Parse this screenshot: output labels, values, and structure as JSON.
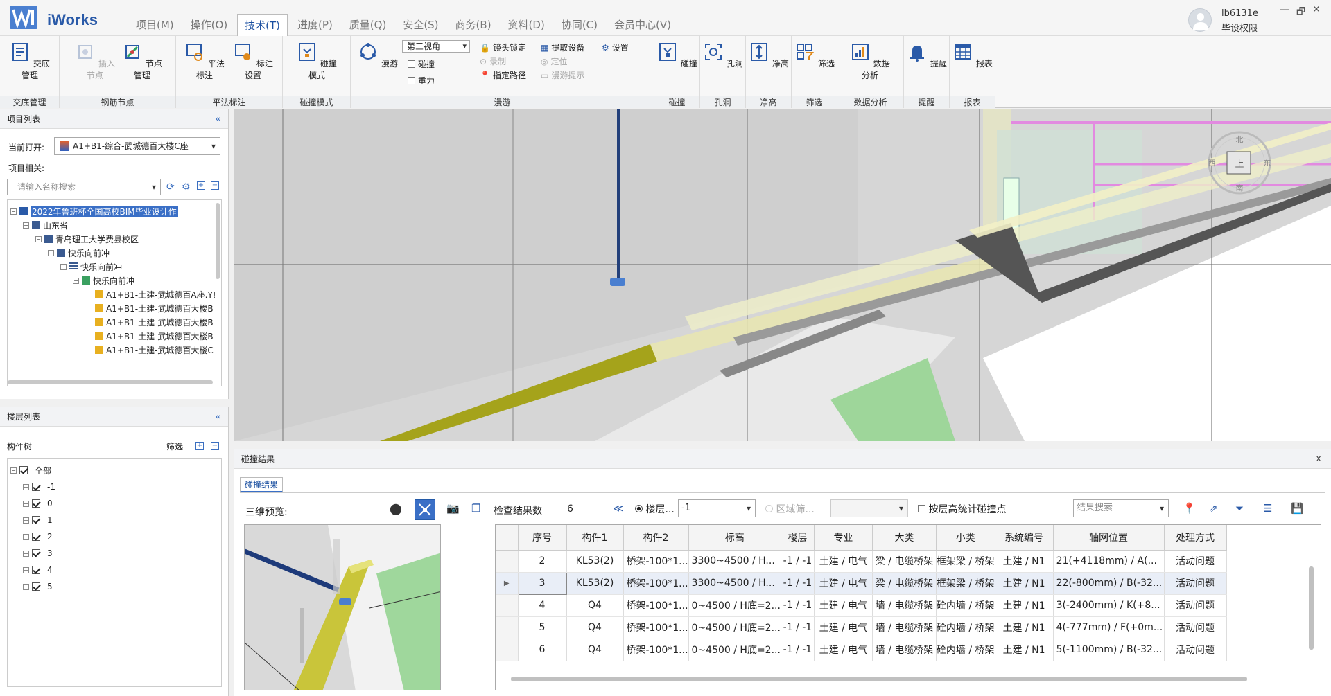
{
  "app": {
    "name": "iWorks"
  },
  "menu": [
    "项目(M)",
    "操作(O)",
    "技术(T)",
    "进度(P)",
    "质量(Q)",
    "安全(S)",
    "商务(B)",
    "资料(D)",
    "协同(C)",
    "会员中心(V)"
  ],
  "menu_active": "技术(T)",
  "user": {
    "name": "lb6131e",
    "role": "毕设权限"
  },
  "window_controls": [
    "—",
    "🗗",
    "✕"
  ],
  "ribbon": {
    "groups": {
      "jiaodi": "交底管理",
      "gangjin": "钢筋节点",
      "pingfa": "平法标注",
      "pengzhuang_mode": "碰撞模式",
      "manyou": "漫游",
      "pengzhuang": "碰撞",
      "kongdong": "孔洞",
      "jinggao": "净高",
      "shaixuan": "筛选",
      "shuju": "数据分析",
      "tixing": "提醒",
      "baobiao": "报表"
    },
    "buttons": {
      "jiaodi": "交底管理",
      "charu": "插入节点",
      "jiedian": "节点管理",
      "pingfa": "平法标注",
      "biaozhu": "标注设置",
      "pengzhuang_mode": "碰撞模式",
      "manyou": "漫游",
      "pengzhuang": "碰撞",
      "kongdong": "孔洞",
      "jinggao": "净高",
      "shaixuan": "筛选",
      "shuju": "数据分析",
      "tixing": "提醒",
      "baobiao": "报表"
    },
    "manyou_opts": {
      "view": "第三视角",
      "pengzhuang_chk": "碰撞",
      "zhongli_chk": "重力",
      "lock": "镜头锁定",
      "record": "录制",
      "path": "指定路径",
      "extract": "提取设备",
      "locate": "定位",
      "tip": "漫游提示",
      "settings": "设置"
    }
  },
  "project_panel": {
    "title": "项目列表",
    "collapse": "«",
    "current_label": "当前打开:",
    "current_value": "A1+B1-综合-武城德百大楼C座",
    "related_label": "项目相关:",
    "search_placeholder": "请输入名称搜索",
    "tree": [
      "2022年鲁班杯全国高校BIM毕业设计作",
      "山东省",
      "青岛理工大学费县校区",
      "快乐向前冲",
      "快乐向前冲",
      "快乐向前冲",
      "A1+B1-土建-武城德百A座.Y!",
      "A1+B1-土建-武城德百大楼B",
      "A1+B1-土建-武城德百大楼B",
      "A1+B1-土建-武城德百大楼B",
      "A1+B1-土建-武城德百大楼C"
    ]
  },
  "floor_panel": {
    "title": "楼层列表",
    "collapse": "«",
    "tree_label": "构件树",
    "filter": "筛选",
    "floors": [
      "全部",
      "-1",
      "0",
      "1",
      "2",
      "3",
      "4",
      "5"
    ]
  },
  "compass": {
    "n": "北",
    "s": "南",
    "w": "西",
    "e": "东",
    "center": "上"
  },
  "results": {
    "title": "碰撞结果",
    "close": "x",
    "tab": "碰撞结果",
    "preview_label": "三维预览:",
    "count_label": "检查结果数",
    "count": "6",
    "floor_radio": "楼层...",
    "floor_value": "-1",
    "region_radio": "区域筛...",
    "stat_chk": "按层高统计碰撞点",
    "search_placeholder": "结果搜索",
    "columns": [
      "序号",
      "构件1",
      "构件2",
      "标高",
      "楼层",
      "专业",
      "大类",
      "小类",
      "系统编号",
      "轴网位置",
      "处理方式"
    ],
    "rows": [
      [
        "2",
        "KL53(2)",
        "桥架-100*1...",
        "3300~4500 / H...",
        "-1 / -1",
        "土建 / 电气",
        "梁 / 电缆桥架",
        "框架梁 / 桥架",
        "土建 / N1",
        "21(+4118mm) / A(...",
        "活动问题"
      ],
      [
        "3",
        "KL53(2)",
        "桥架-100*1...",
        "3300~4500 / H...",
        "-1 / -1",
        "土建 / 电气",
        "梁 / 电缆桥架",
        "框架梁 / 桥架",
        "土建 / N1",
        "22(-800mm) / B(-32...",
        "活动问题"
      ],
      [
        "4",
        "Q4",
        "桥架-100*1...",
        "0~4500 / H底=2...",
        "-1 / -1",
        "土建 / 电气",
        "墙 / 电缆桥架",
        "砼内墙 / 桥架",
        "土建 / N1",
        "3(-2400mm) / K(+8...",
        "活动问题"
      ],
      [
        "5",
        "Q4",
        "桥架-100*1...",
        "0~4500 / H底=2...",
        "-1 / -1",
        "土建 / 电气",
        "墙 / 电缆桥架",
        "砼内墙 / 桥架",
        "土建 / N1",
        "4(-777mm) / F(+0m...",
        "活动问题"
      ],
      [
        "6",
        "Q4",
        "桥架-100*1...",
        "0~4500 / H底=2...",
        "-1 / -1",
        "土建 / 电气",
        "墙 / 电缆桥架",
        "砼内墙 / 桥架",
        "土建 / N1",
        "5(-1100mm) / B(-32...",
        "活动问题"
      ]
    ],
    "selected_row": "3"
  },
  "colors": {
    "accent": "#3a6fc6",
    "brand": "#2a5aa8",
    "tray": "#c8c431"
  }
}
